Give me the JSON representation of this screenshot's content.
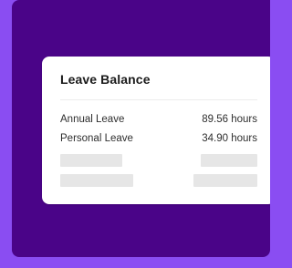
{
  "leave_balance": {
    "title": "Leave Balance",
    "rows": [
      {
        "label": "Annual Leave",
        "value": "89.56 hours"
      },
      {
        "label": "Personal Leave",
        "value": "34.90 hours"
      }
    ],
    "placeholder_rows": 2
  },
  "colors": {
    "background_accent": "#8a4df2",
    "panel": "#4a0488",
    "card": "#ffffff",
    "skeleton": "#e6e6e6"
  }
}
